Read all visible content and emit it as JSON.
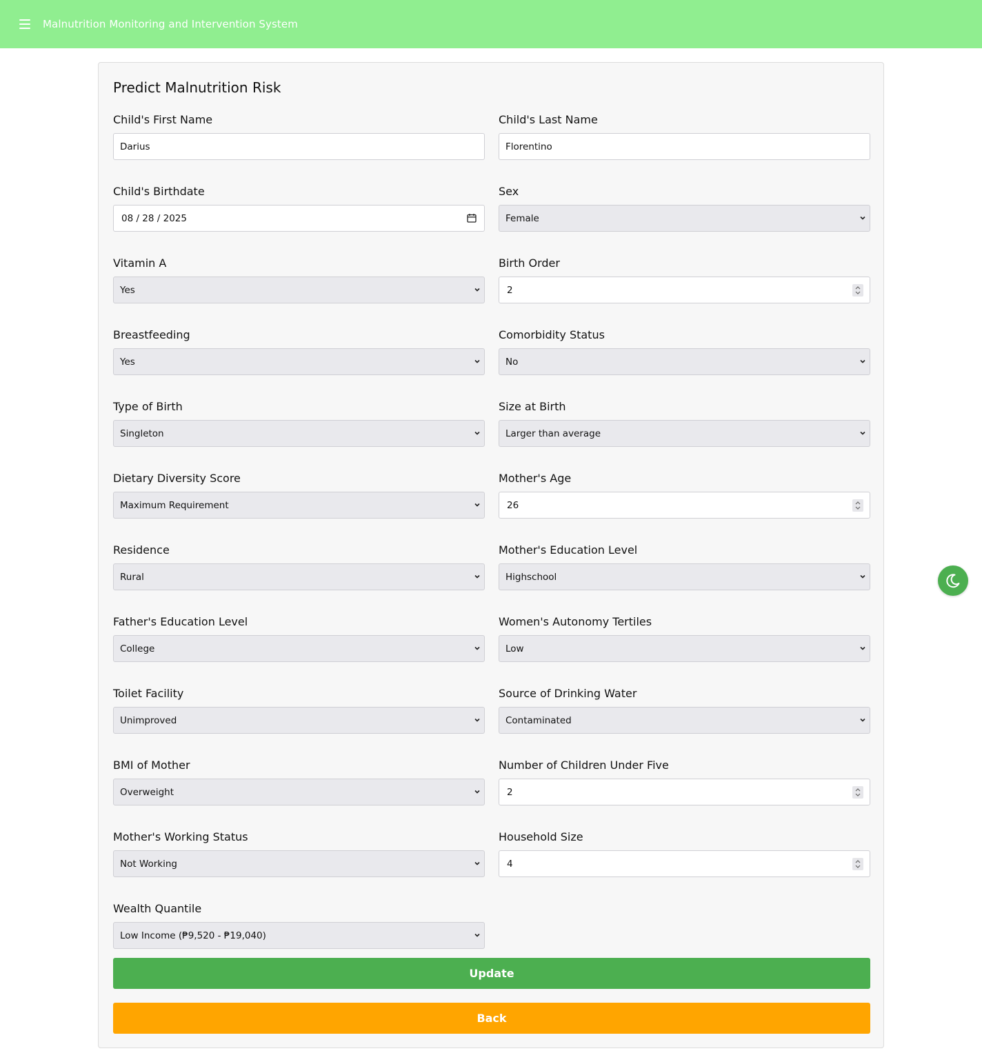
{
  "header": {
    "title": "Malnutrition Monitoring and Intervention System"
  },
  "form": {
    "title": "Predict Malnutrition Risk",
    "fields": {
      "first_name": {
        "label": "Child's First Name",
        "value": "Darius"
      },
      "last_name": {
        "label": "Child's Last Name",
        "value": "Florentino"
      },
      "birthdate": {
        "label": "Child's Birthdate",
        "value": "08 / 28 / 2025"
      },
      "sex": {
        "label": "Sex",
        "value": "Female"
      },
      "vitamin_a": {
        "label": "Vitamin A",
        "value": "Yes"
      },
      "birth_order": {
        "label": "Birth Order",
        "value": "2"
      },
      "breastfeeding": {
        "label": "Breastfeeding",
        "value": "Yes"
      },
      "comorbidity": {
        "label": "Comorbidity Status",
        "value": "No"
      },
      "type_of_birth": {
        "label": "Type of Birth",
        "value": "Singleton"
      },
      "size_at_birth": {
        "label": "Size at Birth",
        "value": "Larger than average"
      },
      "dietary_diversity": {
        "label": "Dietary Diversity Score",
        "value": "Maximum Requirement"
      },
      "mother_age": {
        "label": "Mother's Age",
        "value": "26"
      },
      "residence": {
        "label": "Residence",
        "value": "Rural"
      },
      "mother_education": {
        "label": "Mother's Education Level",
        "value": "Highschool"
      },
      "father_education": {
        "label": "Father's Education Level",
        "value": "College"
      },
      "women_autonomy": {
        "label": "Women's Autonomy Tertiles",
        "value": "Low"
      },
      "toilet_facility": {
        "label": "Toilet Facility",
        "value": "Unimproved"
      },
      "drinking_water": {
        "label": "Source of Drinking Water",
        "value": "Contaminated"
      },
      "mother_bmi": {
        "label": "BMI of Mother",
        "value": "Overweight"
      },
      "children_under_five": {
        "label": "Number of Children Under Five",
        "value": "2"
      },
      "mother_working": {
        "label": "Mother's Working Status",
        "value": "Not Working"
      },
      "household_size": {
        "label": "Household Size",
        "value": "4"
      },
      "wealth_quantile": {
        "label": "Wealth Quantile",
        "value": "Low Income (₱9,520 - ₱19,040)"
      }
    },
    "buttons": {
      "update": "Update",
      "back": "Back"
    }
  },
  "icons": {
    "menu": "hamburger-menu-icon",
    "calendar": "calendar-icon",
    "chevron": "chevron-down-icon",
    "theme": "moon-icon"
  },
  "colors": {
    "topbar": "#90ee90",
    "update_button": "#4caf50",
    "back_button": "#ffa500",
    "theme_button": "#4caf50"
  }
}
